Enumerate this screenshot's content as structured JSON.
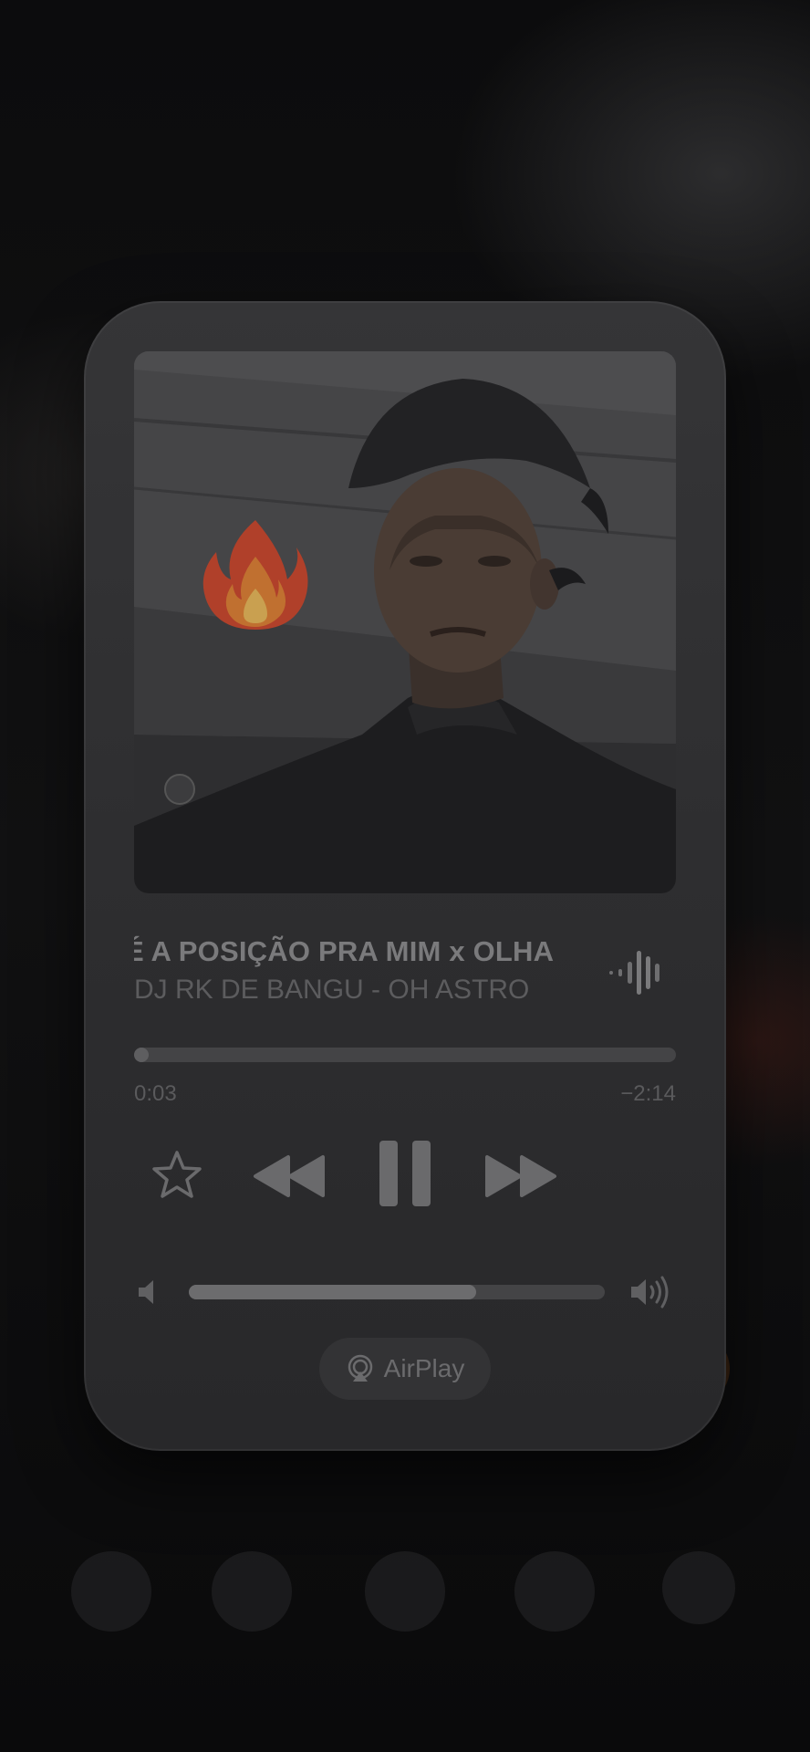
{
  "player": {
    "title": "É A POSIÇÃO PRA MIM  x  OLHA",
    "artist": "DJ RK DE BANGU - OH ASTRO",
    "progress": {
      "elapsed": "0:03",
      "remaining": "−2:14",
      "fraction": 0.022
    },
    "volume": {
      "fraction": 0.69
    },
    "airplay_label": "AirPlay",
    "icons": {
      "artwork_sticker": "fire-emoji",
      "wave": "waveform-icon",
      "favorite": "star-icon",
      "rewind": "rewind-icon",
      "pause": "pause-icon",
      "forward": "fast-forward-icon",
      "volume_low": "speaker-low-icon",
      "volume_high": "speaker-high-icon",
      "airplay": "airplay-icon"
    },
    "colors": {
      "card": "#2f2f31",
      "title": "#7a7a7c",
      "artist": "#5c5c5e",
      "controls": "#6a6a6c"
    }
  }
}
